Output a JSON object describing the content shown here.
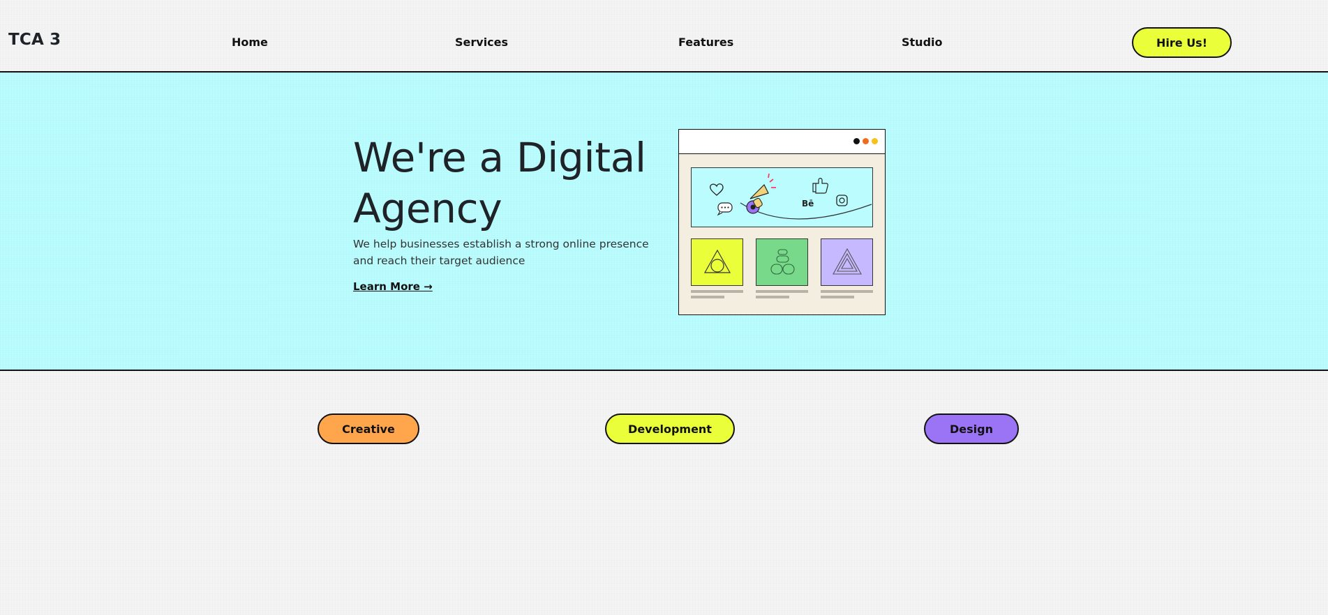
{
  "header": {
    "logo": "TCA 3",
    "nav": [
      {
        "label": "Home"
      },
      {
        "label": "Services"
      },
      {
        "label": "Features"
      },
      {
        "label": "Studio"
      }
    ],
    "cta_label": "Hire Us!"
  },
  "hero": {
    "title": "We're a Digital Agency",
    "description": "We help businesses establish a strong online presence and reach their target audience",
    "link_label": "Learn More →",
    "illustration": {
      "banner_text": "Bē"
    }
  },
  "categories": [
    {
      "label": "Creative",
      "color": "#ffa64d"
    },
    {
      "label": "Development",
      "color": "#eaff3a"
    },
    {
      "label": "Design",
      "color": "#9b74f5"
    }
  ],
  "colors": {
    "hero_bg": "#bbfdfe",
    "accent_yellow": "#eaff3a",
    "accent_orange": "#ffa64d",
    "accent_purple": "#9b74f5",
    "accent_green": "#79d98b"
  }
}
